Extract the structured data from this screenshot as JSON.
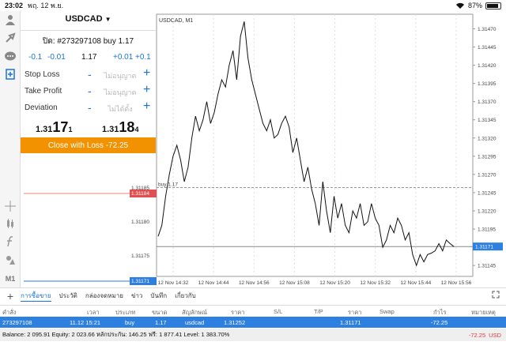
{
  "status": {
    "time": "23:02",
    "date": "พฤ. 12 พ.ย.",
    "battery": "87%"
  },
  "toolbar": {
    "icons": [
      "person-icon",
      "trade-icon",
      "chat-icon",
      "new-order-icon",
      "crosshair-icon",
      "bars-icon",
      "function-icon",
      "objects-icon",
      "timeframe-icon"
    ],
    "timeframe": "M1"
  },
  "order": {
    "symbol": "USDCAD",
    "title": "ปิด: #273297108 buy 1.17",
    "steps": [
      "-0.1",
      "-0.01",
      "1.17",
      "+0.01",
      "+0.1"
    ],
    "stop_loss": {
      "label": "Stop Loss",
      "value": "ไม่อนุญาต"
    },
    "take_profit": {
      "label": "Take Profit",
      "value": "ไม่อนุญาต"
    },
    "deviation": {
      "label": "Deviation",
      "value": "ไม่ได้ตั้ง"
    },
    "bid": {
      "prefix": "1.31",
      "big": "17",
      "sup": "1"
    },
    "ask": {
      "prefix": "1.31",
      "big": "18",
      "sup": "4"
    },
    "close_label": "Close with Loss -72.25",
    "minus": "-",
    "plus": "+"
  },
  "chart": {
    "title": "USDCAD, M1",
    "buy_label": "buy 1.17",
    "bid_tag": "1.31171",
    "left_bid_tag": "1.31184",
    "left_bottom_tag": "1.31171"
  },
  "chart_data": {
    "type": "line",
    "title": "USDCAD, M1",
    "x": [
      "12 Nov 14:32",
      "12 Nov 14:44",
      "12 Nov 14:56",
      "12 Nov 15:08",
      "12 Nov 15:20",
      "12 Nov 15:32",
      "12 Nov 15:44",
      "12 Nov 15:56"
    ],
    "y_ticks": [
      "1.31470",
      "1.31445",
      "1.31420",
      "1.31395",
      "1.31370",
      "1.31345",
      "1.31320",
      "1.31295",
      "1.31270",
      "1.31245",
      "1.31220",
      "1.31195",
      "1.31171",
      "1.31145"
    ],
    "left_y_ticks": [
      "1.31185",
      "1.31180",
      "1.31175"
    ],
    "ylim": [
      1.3113,
      1.3149
    ],
    "buy_level": 1.31252,
    "bid_level": 1.31171,
    "series": [
      {
        "values": [
          1.31185,
          1.312,
          1.3124,
          1.3127,
          1.31295,
          1.3131,
          1.3129,
          1.3126,
          1.3128,
          1.3132,
          1.3135,
          1.3133,
          1.31345,
          1.3137,
          1.3134,
          1.31355,
          1.3138,
          1.314,
          1.3139,
          1.3142,
          1.3144,
          1.314,
          1.3146,
          1.3148,
          1.3143,
          1.314,
          1.3138,
          1.3136,
          1.3134,
          1.3133,
          1.31345,
          1.3132,
          1.31325,
          1.3134,
          1.3135,
          1.31335,
          1.313,
          1.3132,
          1.3129,
          1.3126,
          1.3128,
          1.3125,
          1.3123,
          1.312,
          1.3126,
          1.3122,
          1.3119,
          1.3124,
          1.3121,
          1.3123,
          1.312,
          1.3119,
          1.3122,
          1.3121,
          1.3123,
          1.312,
          1.31205,
          1.3123,
          1.3121,
          1.312,
          1.3117,
          1.3118,
          1.312,
          1.3119,
          1.3121,
          1.312,
          1.3118,
          1.3119,
          1.3116,
          1.31145,
          1.3116,
          1.3115,
          1.3116,
          1.31162,
          1.31165,
          1.31175,
          1.31165,
          1.3118,
          1.31175,
          1.31171
        ]
      }
    ]
  },
  "tabs": [
    "การซื้อขาย",
    "ประวัติ",
    "กล่องจดหมาย",
    "ข่าว",
    "บันทึก",
    "เกี่ยวกับ"
  ],
  "table": {
    "headers": [
      "คำสั่ง",
      "เวลา",
      "ประเภท",
      "ขนาด",
      "สัญลักษณ์",
      "ราคา",
      "S/L",
      "T/P",
      "ราคา",
      "Swap",
      "กำไร",
      "หมายเหตุ"
    ],
    "row": [
      "273297108",
      "11.12 15:21",
      "buy",
      "1.17",
      "usdcad",
      "1.31252",
      "",
      "",
      "1.31171",
      "",
      "-72.25",
      ""
    ]
  },
  "footer": {
    "summary": "Balance: 2 095.91 Equity: 2 023.66 หลักประกัน: 146.25 ฟรี: 1 877.41 Level: 1 383.70%",
    "total": "-72.25",
    "currency": "USD"
  },
  "colors": {
    "accent": "#1a73d8",
    "close_button": "#f39200",
    "bid_tag": "#e05050",
    "ask_tag": "#2d7fe0"
  }
}
